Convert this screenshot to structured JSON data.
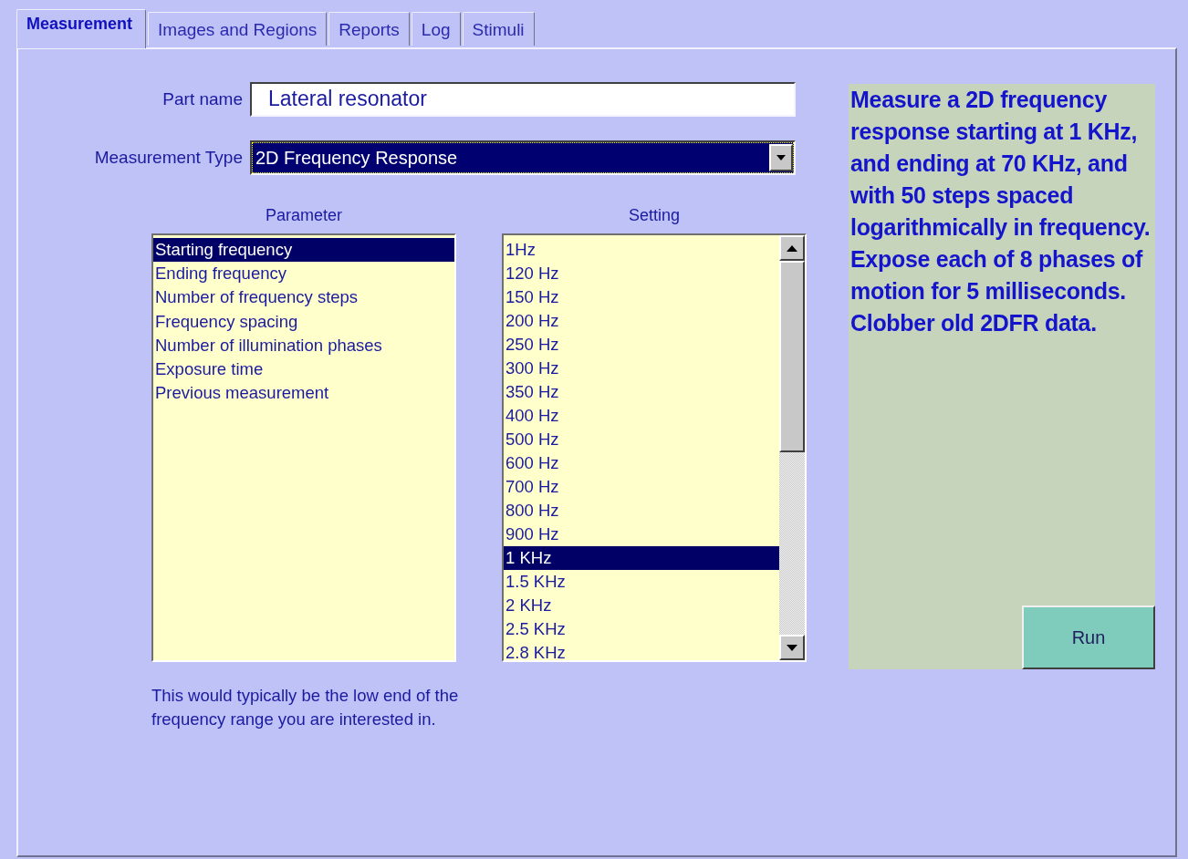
{
  "tabs": [
    {
      "label": "Measurement",
      "selected": true
    },
    {
      "label": "Images and Regions",
      "selected": false
    },
    {
      "label": "Reports",
      "selected": false
    },
    {
      "label": "Log",
      "selected": false
    },
    {
      "label": "Stimuli",
      "selected": false
    }
  ],
  "form": {
    "part_name": {
      "label": "Part name",
      "value": "Lateral resonator"
    },
    "measurement_type": {
      "label": "Measurement Type",
      "value": "2D Frequency Response"
    }
  },
  "parameters": {
    "heading": "Parameter",
    "items": [
      {
        "label": "Starting frequency",
        "selected": true
      },
      {
        "label": "Ending frequency",
        "selected": false
      },
      {
        "label": "Number of frequency steps",
        "selected": false
      },
      {
        "label": "Frequency spacing",
        "selected": false
      },
      {
        "label": "Number of illumination phases",
        "selected": false
      },
      {
        "label": "Exposure time",
        "selected": false
      },
      {
        "label": "Previous measurement",
        "selected": false
      }
    ]
  },
  "settings": {
    "heading": "Setting",
    "items": [
      {
        "label": "1Hz",
        "selected": false
      },
      {
        "label": "120 Hz",
        "selected": false
      },
      {
        "label": "150 Hz",
        "selected": false
      },
      {
        "label": "200 Hz",
        "selected": false
      },
      {
        "label": "250 Hz",
        "selected": false
      },
      {
        "label": "300 Hz",
        "selected": false
      },
      {
        "label": "350 Hz",
        "selected": false
      },
      {
        "label": "400 Hz",
        "selected": false
      },
      {
        "label": "500 Hz",
        "selected": false
      },
      {
        "label": "600 Hz",
        "selected": false
      },
      {
        "label": "700 Hz",
        "selected": false
      },
      {
        "label": "800 Hz",
        "selected": false
      },
      {
        "label": "900 Hz",
        "selected": false
      },
      {
        "label": "1 KHz",
        "selected": true
      },
      {
        "label": "1.5 KHz",
        "selected": false
      },
      {
        "label": "2 KHz",
        "selected": false
      },
      {
        "label": "2.5 KHz",
        "selected": false
      },
      {
        "label": "2.8 KHz",
        "selected": false
      }
    ]
  },
  "hint": "This would typically be the low end of the frequency range you are interested in.",
  "description": "Measure a 2D frequency response starting at 1 KHz, and ending at 70 KHz, and with 50 steps spaced logarithmically in frequency.  Expose each of 8 phases of motion for 5 milliseconds.   Clobber old 2DFR data.",
  "run_button": "Run"
}
